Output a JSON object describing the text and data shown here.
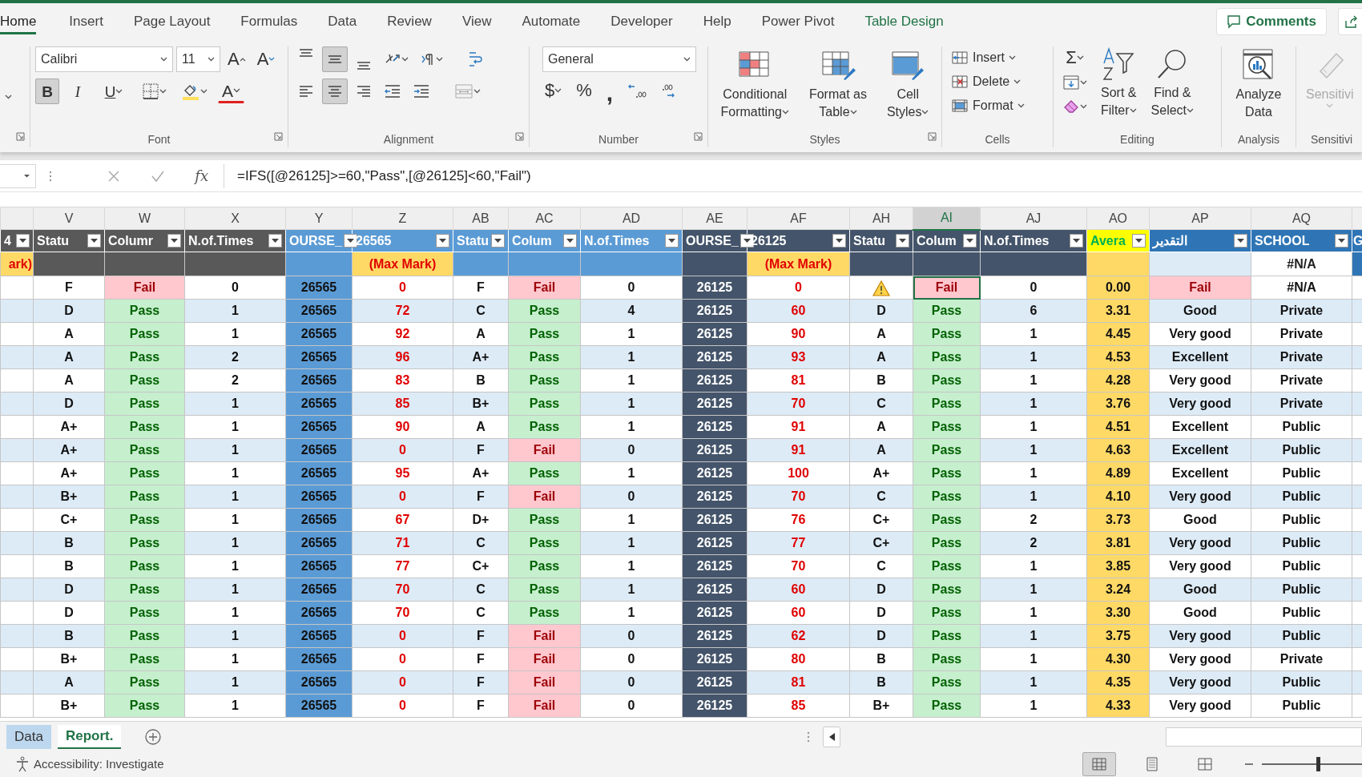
{
  "ribbon_tabs": [
    {
      "label": "Home",
      "selected": true,
      "kind": "standard"
    },
    {
      "label": "Insert",
      "selected": false,
      "kind": "standard"
    },
    {
      "label": "Page Layout",
      "selected": false,
      "kind": "standard"
    },
    {
      "label": "Formulas",
      "selected": false,
      "kind": "standard"
    },
    {
      "label": "Data",
      "selected": false,
      "kind": "standard"
    },
    {
      "label": "Review",
      "selected": false,
      "kind": "standard"
    },
    {
      "label": "View",
      "selected": false,
      "kind": "standard"
    },
    {
      "label": "Automate",
      "selected": false,
      "kind": "standard"
    },
    {
      "label": "Developer",
      "selected": false,
      "kind": "standard"
    },
    {
      "label": "Help",
      "selected": false,
      "kind": "standard"
    },
    {
      "label": "Power Pivot",
      "selected": false,
      "kind": "standard"
    },
    {
      "label": "Table Design",
      "selected": false,
      "kind": "contextual"
    }
  ],
  "comments_button": "Comments",
  "ribbon": {
    "font": {
      "label": "Font",
      "name": "Calibri",
      "size": "11",
      "grow": "A",
      "shrink": "A",
      "font_color": "A",
      "styles": [
        {
          "kind": "bold",
          "label": "B",
          "on": true
        },
        {
          "kind": "italic",
          "label": "I",
          "on": false
        },
        {
          "kind": "underline",
          "label": "U",
          "on": false
        }
      ]
    },
    "alignment": {
      "label": "Alignment",
      "vertical": [
        {
          "kind": "top",
          "on": false
        },
        {
          "kind": "middle",
          "on": true
        },
        {
          "kind": "bottom",
          "on": false
        }
      ],
      "horizontal": [
        {
          "kind": "left",
          "on": false
        },
        {
          "kind": "center",
          "on": true
        },
        {
          "kind": "right",
          "on": false
        }
      ],
      "merge_disabled": true
    },
    "number": {
      "label": "Number",
      "format": "General",
      "currency": "$",
      "percent": "%",
      "comma": ","
    },
    "styles": {
      "label": "Styles",
      "buttons": [
        {
          "kind": "conditional",
          "lines": [
            "Conditional",
            "Formatting"
          ]
        },
        {
          "kind": "table",
          "lines": [
            "Format as",
            "Table"
          ]
        },
        {
          "kind": "cell",
          "lines": [
            "Cell",
            "Styles"
          ]
        }
      ]
    },
    "cells": {
      "label": "Cells",
      "buttons": [
        {
          "kind": "insert",
          "label": "Insert"
        },
        {
          "kind": "delete",
          "label": "Delete"
        },
        {
          "kind": "format",
          "label": "Format"
        }
      ]
    },
    "editing": {
      "label": "Editing",
      "autosum": "Σ",
      "buttons": [
        {
          "kind": "sort",
          "lines": [
            "Sort &",
            "Filter"
          ]
        },
        {
          "kind": "find",
          "lines": [
            "Find &",
            "Select"
          ]
        }
      ]
    },
    "analysis": {
      "label": "Analysis",
      "lines": [
        "Analyze",
        "Data"
      ]
    },
    "sensitivity": {
      "label": "Sensitivi",
      "button": "Sensitivi",
      "disabled": true
    }
  },
  "formula_bar": {
    "function_label": "fx",
    "formula": "=IFS([@26125]>=60,\"Pass\",[@26125]<60,\"Fail\")"
  },
  "table": {
    "columns": [
      {
        "header": "4",
        "max_mark": "ark)",
        "kind": "cut-left",
        "color": "#595959",
        "selected": false
      },
      {
        "letter": "V",
        "header": "Statu",
        "kind": "grade",
        "color": "#595959",
        "selected": false
      },
      {
        "letter": "W",
        "header": "Columr",
        "kind": "status",
        "color": "#595959",
        "selected": false
      },
      {
        "letter": "X",
        "header": "N.of.Times",
        "kind": "count",
        "color": "#595959",
        "selected": false
      },
      {
        "letter": "Y",
        "header": "OURSE_",
        "kind": "course",
        "color": "#5b9bd5",
        "selected": false
      },
      {
        "letter": "Z",
        "header": "26565",
        "max_mark": "(Max Mark)",
        "kind": "mark",
        "color": "#5b9bd5",
        "selected": false
      },
      {
        "letter": "AB",
        "header": "Statu",
        "kind": "grade",
        "color": "#5b9bd5",
        "selected": false
      },
      {
        "letter": "AC",
        "header": "Colum",
        "kind": "status",
        "color": "#5b9bd5",
        "selected": false
      },
      {
        "letter": "AD",
        "header": "N.of.Times",
        "kind": "count",
        "color": "#5b9bd5",
        "selected": false
      },
      {
        "letter": "AE",
        "header": "OURSE_",
        "kind": "course",
        "color": "#44546a",
        "selected": false
      },
      {
        "letter": "AF",
        "header": "26125",
        "max_mark": "(Max Mark)",
        "kind": "mark",
        "color": "#44546a",
        "selected": false
      },
      {
        "letter": "AH",
        "header": "Statu",
        "kind": "grade",
        "color": "#44546a",
        "selected": false
      },
      {
        "letter": "AI",
        "header": "Colum",
        "kind": "status",
        "color": "#44546a",
        "selected": true
      },
      {
        "letter": "AJ",
        "header": "N.of.Times",
        "kind": "count",
        "color": "#44546a",
        "selected": false
      },
      {
        "letter": "AO",
        "header": "Avera",
        "kind": "average",
        "color": "#ffff00",
        "selected": false
      },
      {
        "letter": "AP",
        "header": "التقدير",
        "kind": "rating",
        "color": "#2f75b5",
        "selected": false
      },
      {
        "letter": "AQ",
        "header": "SCHOOL",
        "max_mark": "#N/A",
        "kind": "school",
        "color": "#2f75b5",
        "selected": false
      },
      {
        "header": "G",
        "kind": "cut-right",
        "color": "#2f75b5",
        "selected": false
      }
    ],
    "rows": [
      {
        "selected": true,
        "cells": [
          null,
          "F",
          {
            "text": "Fail",
            "passed": false
          },
          "0",
          "26565",
          "0",
          "F",
          {
            "text": "Fail",
            "passed": false
          },
          "0",
          "26125",
          "0",
          {
            "warning": true
          },
          {
            "text": "Fail",
            "passed": false
          },
          "0",
          "0.00",
          {
            "text": "Fail",
            "passed": false
          },
          "#N/A",
          null
        ]
      },
      {
        "selected": false,
        "cells": [
          null,
          "D",
          {
            "text": "Pass",
            "passed": true
          },
          "1",
          "26565",
          "72",
          "C",
          {
            "text": "Pass",
            "passed": true
          },
          "4",
          "26125",
          "60",
          "D",
          {
            "text": "Pass",
            "passed": true
          },
          "6",
          "3.31",
          {
            "text": "Good",
            "passed": true
          },
          "Private",
          null
        ]
      },
      {
        "selected": false,
        "cells": [
          null,
          "A",
          {
            "text": "Pass",
            "passed": true
          },
          "1",
          "26565",
          "92",
          "A",
          {
            "text": "Pass",
            "passed": true
          },
          "1",
          "26125",
          "90",
          "A",
          {
            "text": "Pass",
            "passed": true
          },
          "1",
          "4.45",
          {
            "text": "Very good",
            "passed": true
          },
          "Private",
          null
        ]
      },
      {
        "selected": false,
        "cells": [
          null,
          "A",
          {
            "text": "Pass",
            "passed": true
          },
          "2",
          "26565",
          "96",
          "A+",
          {
            "text": "Pass",
            "passed": true
          },
          "1",
          "26125",
          "93",
          "A",
          {
            "text": "Pass",
            "passed": true
          },
          "1",
          "4.53",
          {
            "text": "Excellent",
            "passed": true
          },
          "Private",
          null
        ]
      },
      {
        "selected": false,
        "cells": [
          null,
          "A",
          {
            "text": "Pass",
            "passed": true
          },
          "2",
          "26565",
          "83",
          "B",
          {
            "text": "Pass",
            "passed": true
          },
          "1",
          "26125",
          "81",
          "B",
          {
            "text": "Pass",
            "passed": true
          },
          "1",
          "4.28",
          {
            "text": "Very good",
            "passed": true
          },
          "Private",
          null
        ]
      },
      {
        "selected": false,
        "cells": [
          null,
          "D",
          {
            "text": "Pass",
            "passed": true
          },
          "1",
          "26565",
          "85",
          "B+",
          {
            "text": "Pass",
            "passed": true
          },
          "1",
          "26125",
          "70",
          "C",
          {
            "text": "Pass",
            "passed": true
          },
          "1",
          "3.76",
          {
            "text": "Very good",
            "passed": true
          },
          "Private",
          null
        ]
      },
      {
        "selected": false,
        "cells": [
          null,
          "A+",
          {
            "text": "Pass",
            "passed": true
          },
          "1",
          "26565",
          "90",
          "A",
          {
            "text": "Pass",
            "passed": true
          },
          "1",
          "26125",
          "91",
          "A",
          {
            "text": "Pass",
            "passed": true
          },
          "1",
          "4.51",
          {
            "text": "Excellent",
            "passed": true
          },
          "Public",
          null
        ]
      },
      {
        "selected": false,
        "cells": [
          null,
          "A+",
          {
            "text": "Pass",
            "passed": true
          },
          "1",
          "26565",
          "0",
          "F",
          {
            "text": "Fail",
            "passed": false
          },
          "0",
          "26125",
          "91",
          "A",
          {
            "text": "Pass",
            "passed": true
          },
          "1",
          "4.63",
          {
            "text": "Excellent",
            "passed": true
          },
          "Public",
          null
        ]
      },
      {
        "selected": false,
        "cells": [
          null,
          "A+",
          {
            "text": "Pass",
            "passed": true
          },
          "1",
          "26565",
          "95",
          "A+",
          {
            "text": "Pass",
            "passed": true
          },
          "1",
          "26125",
          "100",
          "A+",
          {
            "text": "Pass",
            "passed": true
          },
          "1",
          "4.89",
          {
            "text": "Excellent",
            "passed": true
          },
          "Public",
          null
        ]
      },
      {
        "selected": false,
        "cells": [
          null,
          "B+",
          {
            "text": "Pass",
            "passed": true
          },
          "1",
          "26565",
          "0",
          "F",
          {
            "text": "Fail",
            "passed": false
          },
          "0",
          "26125",
          "70",
          "C",
          {
            "text": "Pass",
            "passed": true
          },
          "1",
          "4.10",
          {
            "text": "Very good",
            "passed": true
          },
          "Public",
          null
        ]
      },
      {
        "selected": false,
        "cells": [
          null,
          "C+",
          {
            "text": "Pass",
            "passed": true
          },
          "1",
          "26565",
          "67",
          "D+",
          {
            "text": "Pass",
            "passed": true
          },
          "1",
          "26125",
          "76",
          "C+",
          {
            "text": "Pass",
            "passed": true
          },
          "2",
          "3.73",
          {
            "text": "Good",
            "passed": true
          },
          "Public",
          null
        ]
      },
      {
        "selected": false,
        "cells": [
          null,
          "B",
          {
            "text": "Pass",
            "passed": true
          },
          "1",
          "26565",
          "71",
          "C",
          {
            "text": "Pass",
            "passed": true
          },
          "1",
          "26125",
          "77",
          "C+",
          {
            "text": "Pass",
            "passed": true
          },
          "2",
          "3.81",
          {
            "text": "Very good",
            "passed": true
          },
          "Public",
          null
        ]
      },
      {
        "selected": false,
        "cells": [
          null,
          "B",
          {
            "text": "Pass",
            "passed": true
          },
          "1",
          "26565",
          "77",
          "C+",
          {
            "text": "Pass",
            "passed": true
          },
          "1",
          "26125",
          "70",
          "C",
          {
            "text": "Pass",
            "passed": true
          },
          "1",
          "3.85",
          {
            "text": "Very good",
            "passed": true
          },
          "Public",
          null
        ]
      },
      {
        "selected": false,
        "cells": [
          null,
          "D",
          {
            "text": "Pass",
            "passed": true
          },
          "1",
          "26565",
          "70",
          "C",
          {
            "text": "Pass",
            "passed": true
          },
          "1",
          "26125",
          "60",
          "D",
          {
            "text": "Pass",
            "passed": true
          },
          "1",
          "3.24",
          {
            "text": "Good",
            "passed": true
          },
          "Public",
          null
        ]
      },
      {
        "selected": false,
        "cells": [
          null,
          "D",
          {
            "text": "Pass",
            "passed": true
          },
          "1",
          "26565",
          "70",
          "C",
          {
            "text": "Pass",
            "passed": true
          },
          "1",
          "26125",
          "60",
          "D",
          {
            "text": "Pass",
            "passed": true
          },
          "1",
          "3.30",
          {
            "text": "Good",
            "passed": true
          },
          "Public",
          null
        ]
      },
      {
        "selected": false,
        "cells": [
          null,
          "B",
          {
            "text": "Pass",
            "passed": true
          },
          "1",
          "26565",
          "0",
          "F",
          {
            "text": "Fail",
            "passed": false
          },
          "0",
          "26125",
          "62",
          "D",
          {
            "text": "Pass",
            "passed": true
          },
          "1",
          "3.75",
          {
            "text": "Very good",
            "passed": true
          },
          "Public",
          null
        ]
      },
      {
        "selected": false,
        "cells": [
          null,
          "B+",
          {
            "text": "Pass",
            "passed": true
          },
          "1",
          "26565",
          "0",
          "F",
          {
            "text": "Fail",
            "passed": false
          },
          "0",
          "26125",
          "80",
          "B",
          {
            "text": "Pass",
            "passed": true
          },
          "1",
          "4.30",
          {
            "text": "Very good",
            "passed": true
          },
          "Private",
          null
        ]
      },
      {
        "selected": false,
        "cells": [
          null,
          "A",
          {
            "text": "Pass",
            "passed": true
          },
          "1",
          "26565",
          "0",
          "F",
          {
            "text": "Fail",
            "passed": false
          },
          "0",
          "26125",
          "81",
          "B",
          {
            "text": "Pass",
            "passed": true
          },
          "1",
          "4.35",
          {
            "text": "Very good",
            "passed": true
          },
          "Public",
          null
        ]
      },
      {
        "selected": false,
        "cells": [
          null,
          "B+",
          {
            "text": "Pass",
            "passed": true
          },
          "1",
          "26565",
          "0",
          "F",
          {
            "text": "Fail",
            "passed": false
          },
          "0",
          "26125",
          "85",
          "B+",
          {
            "text": "Pass",
            "passed": true
          },
          "1",
          "4.33",
          {
            "text": "Very good",
            "passed": true
          },
          "Public",
          null
        ]
      }
    ]
  },
  "sheet_tabs": [
    {
      "label": "Data",
      "selected": false,
      "color": "#bdd7ee"
    },
    {
      "label": "Report.",
      "selected": true
    }
  ],
  "status_bar": {
    "text": "Accessibility: Investigate",
    "views": [
      {
        "kind": "normal",
        "selected": true
      },
      {
        "kind": "page-layout",
        "selected": false
      },
      {
        "kind": "page-break",
        "selected": false
      }
    ],
    "zoom_slider": {
      "level": 0.56
    }
  }
}
